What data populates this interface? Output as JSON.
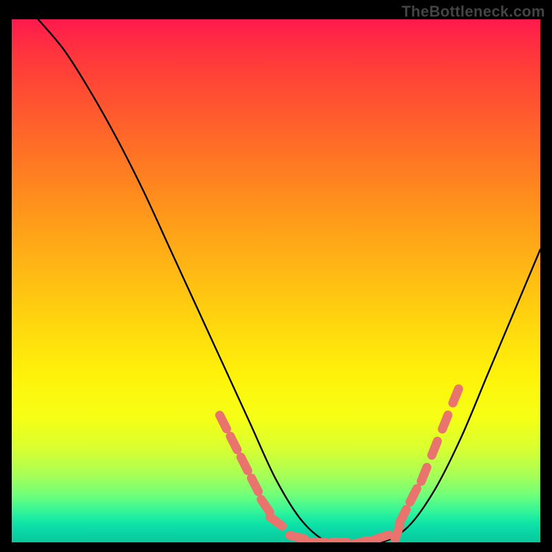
{
  "watermark": "TheBottleneck.com",
  "colors": {
    "background": "#000000",
    "marker": "#e9746e",
    "curve": "#000000",
    "gradient_top": "#ff1a4d",
    "gradient_bottom": "#09c99b"
  },
  "chart_data": {
    "type": "line",
    "title": "",
    "xlabel": "",
    "ylabel": "",
    "xlim": [
      0,
      100
    ],
    "ylim": [
      0,
      100
    ],
    "x": [
      5,
      10,
      15,
      20,
      25,
      30,
      35,
      40,
      45,
      50,
      55,
      60,
      65,
      70,
      75,
      80,
      85,
      90,
      95,
      100
    ],
    "values": [
      100,
      94,
      86,
      77,
      67,
      56,
      45,
      34,
      23,
      12,
      4,
      0,
      0,
      0,
      3,
      10,
      20,
      32,
      44,
      56
    ],
    "marker_x": [
      40,
      42,
      44,
      46,
      48,
      50,
      54,
      58,
      62,
      66,
      70,
      73,
      74,
      76,
      78,
      80,
      82,
      84
    ],
    "marker_y": [
      23,
      19,
      15,
      11,
      7,
      4,
      1,
      0,
      0,
      0,
      1,
      2,
      5,
      9,
      13,
      18,
      23,
      28
    ]
  }
}
